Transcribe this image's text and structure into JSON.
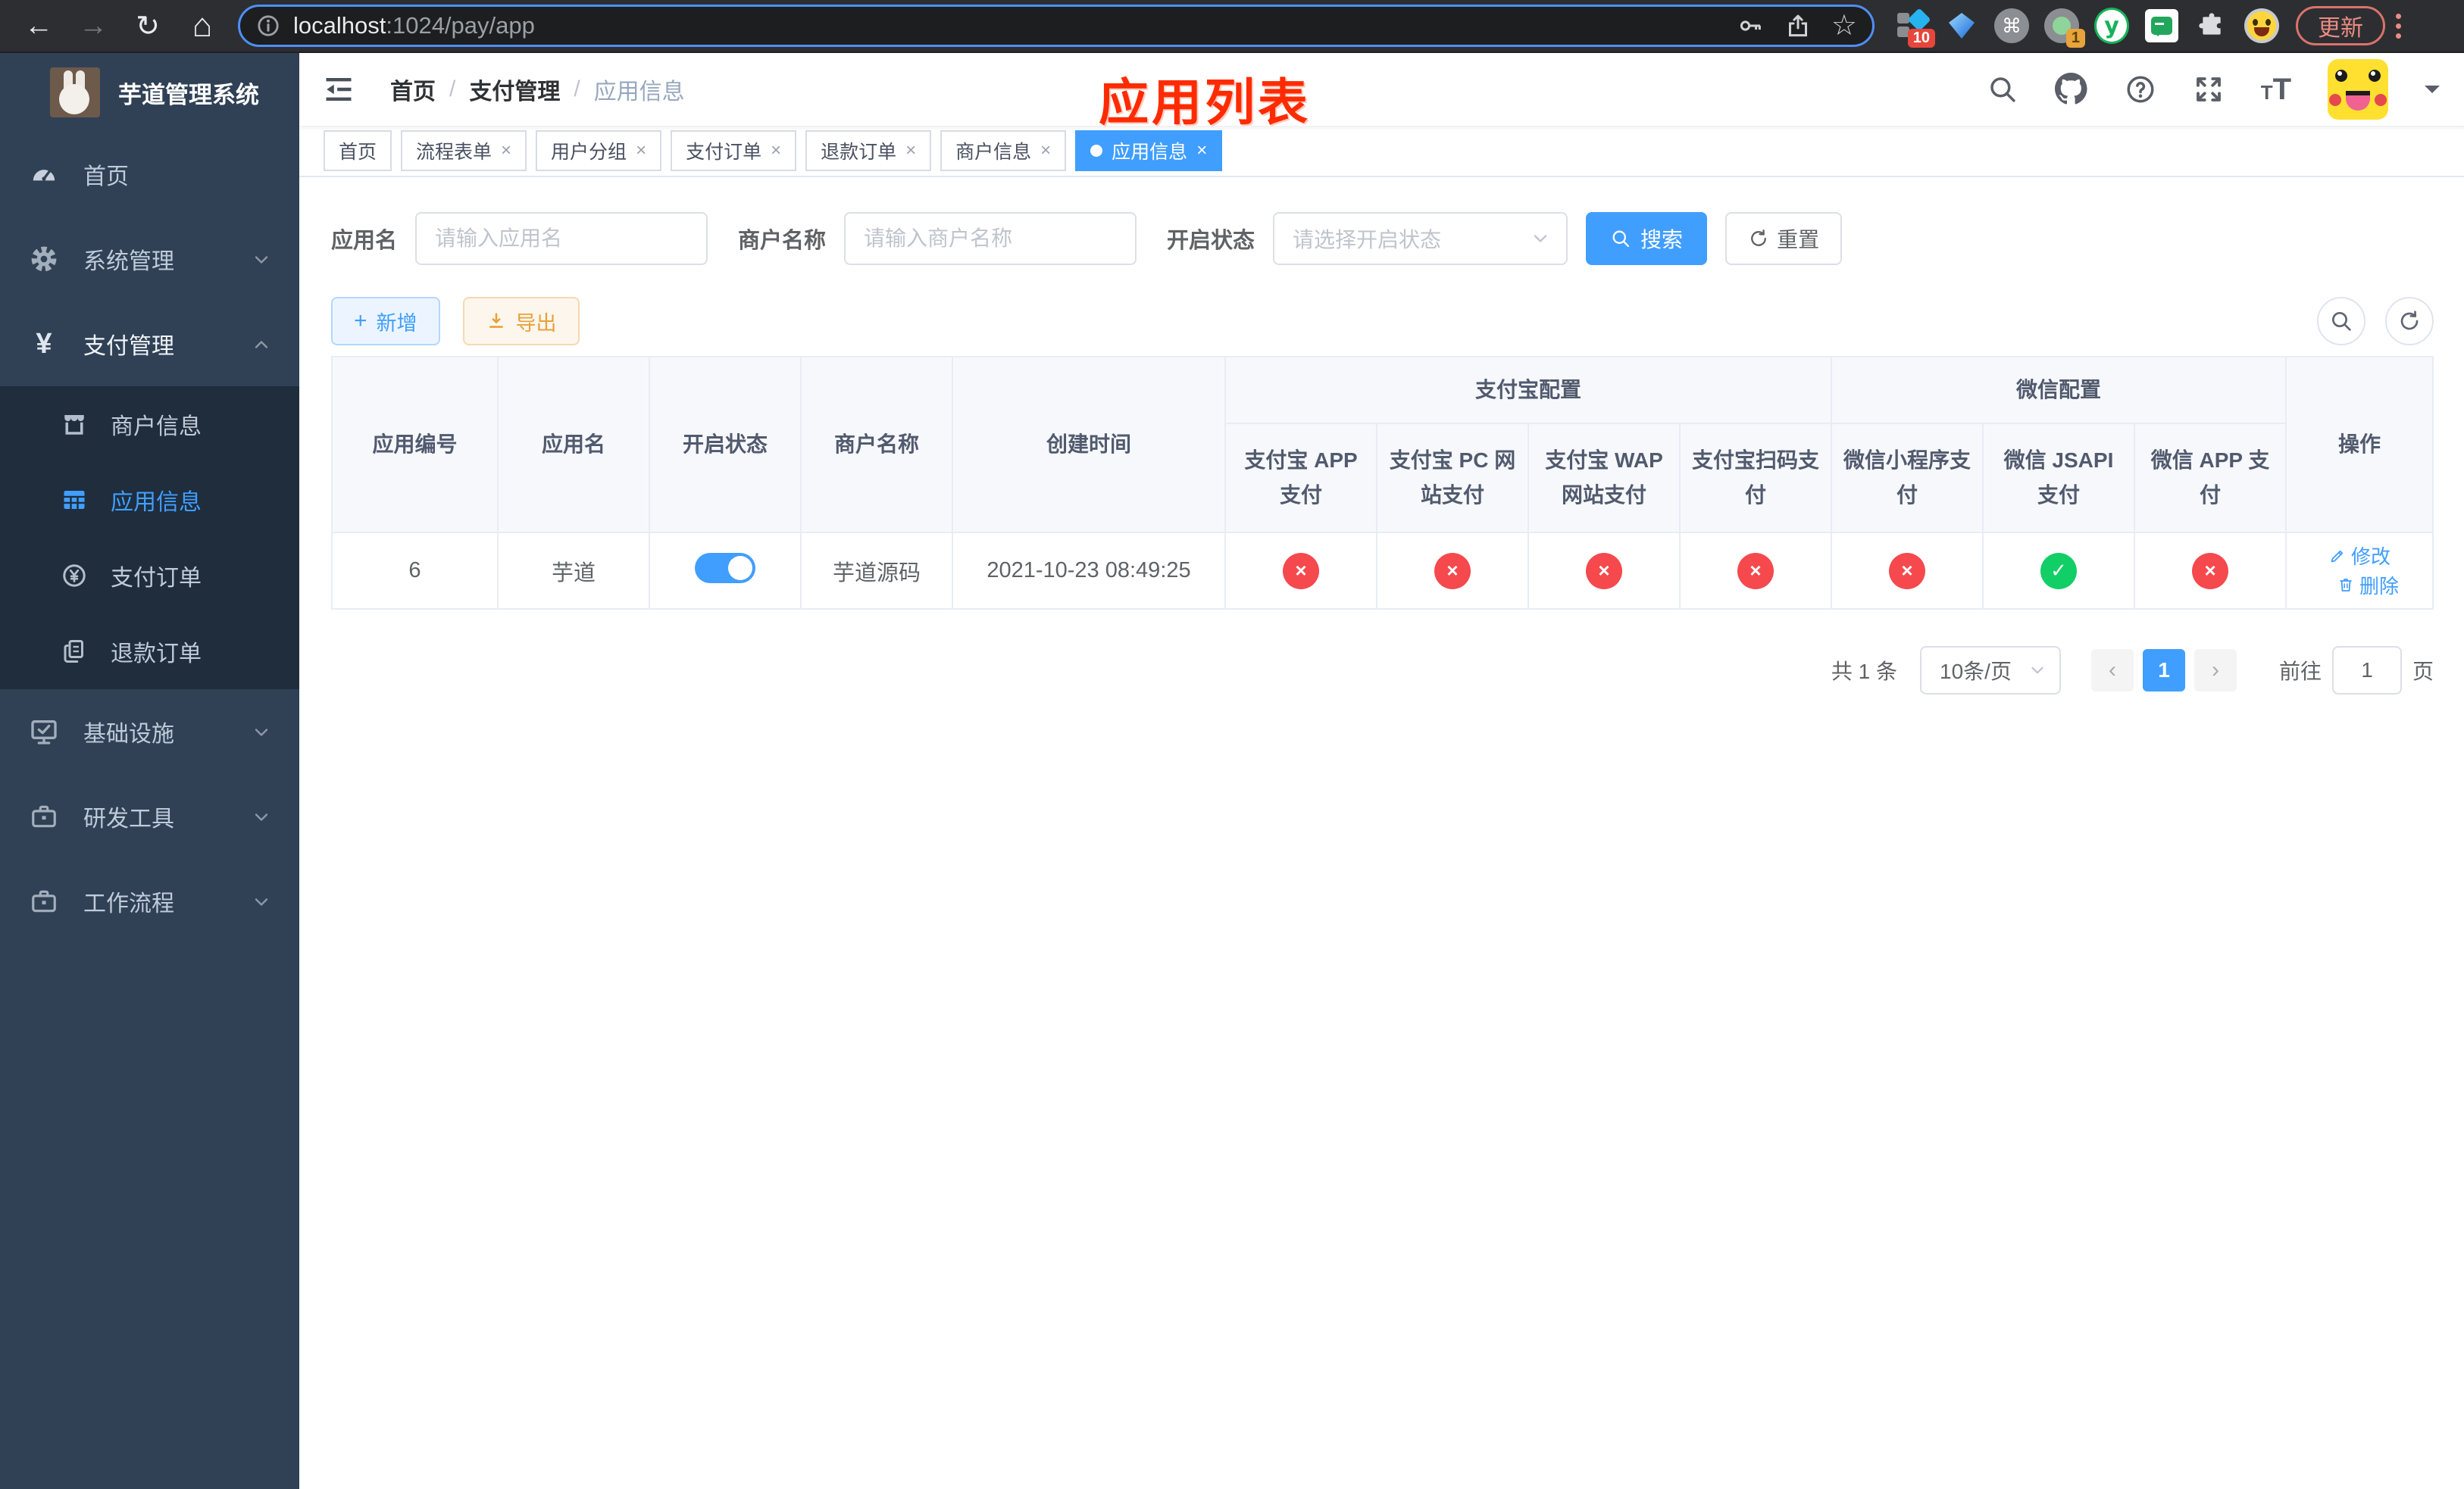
{
  "colors": {
    "accent": "#409eff",
    "danger": "#f5494d",
    "success": "#12ce66",
    "annotation": "#fe2b00"
  },
  "browser": {
    "url": {
      "host": "localhost",
      "path": ":1024/pay/app"
    },
    "extensions": {
      "badge_ten": "10",
      "badge_one": "1",
      "y_logo": "y",
      "command_glyph": "⌘"
    },
    "update_label": "更新"
  },
  "sidebar": {
    "title": "芋道管理系统",
    "items": [
      {
        "label": "首页"
      },
      {
        "label": "系统管理"
      },
      {
        "label": "支付管理"
      },
      {
        "label": "基础设施"
      },
      {
        "label": "研发工具"
      },
      {
        "label": "工作流程"
      }
    ],
    "pay_children": [
      {
        "label": "商户信息"
      },
      {
        "label": "应用信息"
      },
      {
        "label": "支付订单"
      },
      {
        "label": "退款订单"
      }
    ]
  },
  "navbar": {
    "breadcrumb": [
      "首页",
      "支付管理",
      "应用信息"
    ],
    "separator": "/",
    "annotation": "应用列表"
  },
  "tabs": [
    {
      "label": "首页"
    },
    {
      "label": "流程表单"
    },
    {
      "label": "用户分组"
    },
    {
      "label": "支付订单"
    },
    {
      "label": "退款订单"
    },
    {
      "label": "商户信息"
    },
    {
      "label": "应用信息"
    }
  ],
  "filters": {
    "app_name_label": "应用名",
    "app_name_placeholder": "请输入应用名",
    "merchant_label": "商户名称",
    "merchant_placeholder": "请输入商户名称",
    "status_label": "开启状态",
    "status_placeholder": "请选择开启状态",
    "search_label": "搜索",
    "reset_label": "重置"
  },
  "toolbar": {
    "add_label": "新增",
    "export_label": "导出"
  },
  "table": {
    "plain_columns": [
      "应用编号",
      "应用名",
      "开启状态",
      "商户名称",
      "创建时间"
    ],
    "groups": [
      {
        "label": "支付宝配置",
        "children": [
          "支付宝 APP 支付",
          "支付宝 PC 网站支付",
          "支付宝 WAP 网站支付",
          "支付宝扫码支付"
        ]
      },
      {
        "label": "微信配置",
        "children": [
          "微信小程序支付",
          "微信 JSAPI 支付",
          "微信 APP 支付"
        ]
      }
    ],
    "ops_header": "操作",
    "row": {
      "id": "6",
      "name": "芋道",
      "enabled": true,
      "merchant": "芋道源码",
      "created": "2021-10-23 08:49:25",
      "channels": [
        false,
        false,
        false,
        false,
        false,
        true,
        false
      ],
      "ops": {
        "edit": "修改",
        "delete": "删除"
      }
    }
  },
  "pagination": {
    "total": "共 1 条",
    "page_size": "10条/页",
    "current": "1",
    "goto": "前往",
    "goto_value": "1",
    "unit": "页"
  }
}
